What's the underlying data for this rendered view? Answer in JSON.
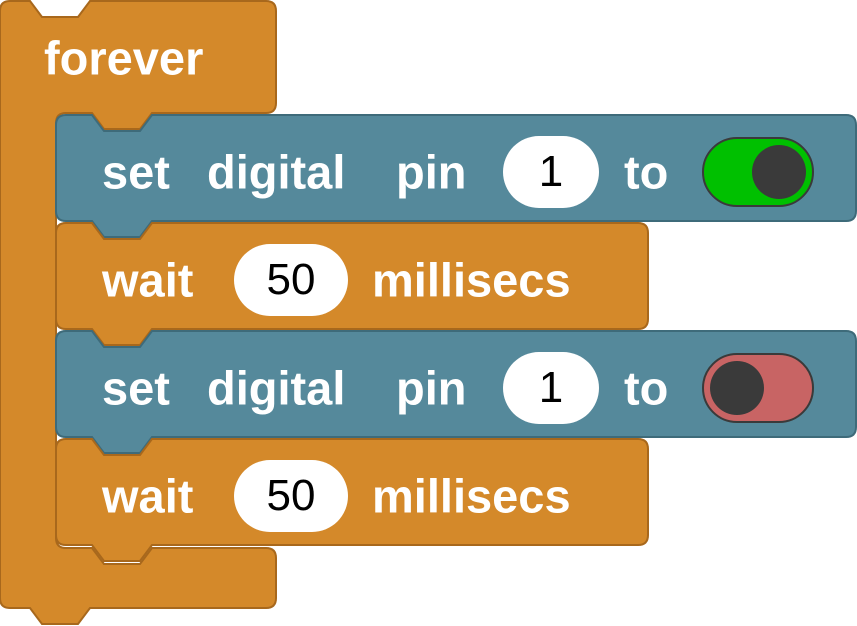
{
  "colors": {
    "control_block": "#D4892A",
    "control_block_border": "#A8681C",
    "io_block": "#55899B",
    "io_block_border": "#3E6B7A",
    "toggle_on": "#00C000",
    "toggle_off": "#C86464",
    "knob": "#3A3A3A"
  },
  "forever_block": {
    "label": "forever"
  },
  "blocks": [
    {
      "type": "set_digital_pin",
      "label_set": "set",
      "label_digital": "digital",
      "label_pin": "pin",
      "pin_value": "1",
      "label_to": "to",
      "toggle_state": "on"
    },
    {
      "type": "wait",
      "label_wait": "wait",
      "duration_value": "50",
      "label_unit": "millisecs"
    },
    {
      "type": "set_digital_pin",
      "label_set": "set",
      "label_digital": "digital",
      "label_pin": "pin",
      "pin_value": "1",
      "label_to": "to",
      "toggle_state": "off"
    },
    {
      "type": "wait",
      "label_wait": "wait",
      "duration_value": "50",
      "label_unit": "millisecs"
    }
  ]
}
